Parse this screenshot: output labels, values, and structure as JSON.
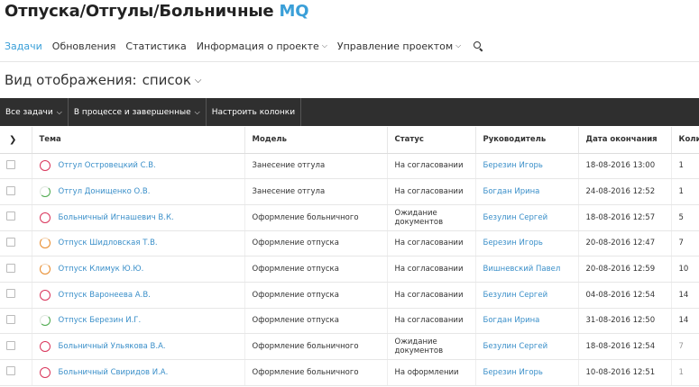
{
  "app": {
    "title_main": "Отпуска/Отгулы/Больничные",
    "title_accent": "MQ"
  },
  "nav": {
    "items": [
      {
        "label": "Задачи",
        "active": true,
        "dropdown": false
      },
      {
        "label": "Обновления",
        "active": false,
        "dropdown": false
      },
      {
        "label": "Статистика",
        "active": false,
        "dropdown": false
      },
      {
        "label": "Информация о проекте",
        "active": false,
        "dropdown": true
      },
      {
        "label": "Управление проектом",
        "active": false,
        "dropdown": true
      }
    ],
    "search_icon": "search-icon"
  },
  "view": {
    "label": "Вид отображения:",
    "value": "список"
  },
  "toolbar": {
    "all_tasks": "Все задачи",
    "in_progress": "В процессе и завершенные",
    "configure": "Настроить колонки"
  },
  "table": {
    "columns": {
      "topic": "Тема",
      "model": "Модель",
      "status": "Статус",
      "manager": "Руководитель",
      "end_date": "Дата окончания",
      "count": "Коли"
    },
    "rows": [
      {
        "topic": "Отгул Островецкий С.В.",
        "model": "Занесение отгула",
        "status": "На согласовании",
        "manager": "Березин Игорь",
        "end_date": "18-08-2016 13:00",
        "count": "1",
        "icon": "red"
      },
      {
        "topic": "Отгул Донищенко О.В.",
        "model": "Занесение отгула",
        "status": "На согласовании",
        "manager": "Богдан Ирина",
        "end_date": "24-08-2016 12:52",
        "count": "1",
        "icon": "green"
      },
      {
        "topic": "Больничный Игнашевич В.К.",
        "model": "Оформление больничного",
        "status": "Ожидание документов",
        "manager": "Безулин Сергей",
        "end_date": "18-08-2016 12:57",
        "count": "5",
        "icon": "red"
      },
      {
        "topic": "Отпуск Шидловская Т.В.",
        "model": "Оформление отпуска",
        "status": "На согласовании",
        "manager": "Березин Игорь",
        "end_date": "20-08-2016 12:47",
        "count": "7",
        "icon": "orange"
      },
      {
        "topic": "Отпуск Климук Ю.Ю.",
        "model": "Оформление отпуска",
        "status": "На согласовании",
        "manager": "Вишневский Павел",
        "end_date": "20-08-2016 12:59",
        "count": "10",
        "icon": "orange"
      },
      {
        "topic": "Отпуск Варонеева А.В.",
        "model": "Оформление отпуска",
        "status": "На согласовании",
        "manager": "Безулин Сергей",
        "end_date": "04-08-2016 12:54",
        "count": "14",
        "icon": "red"
      },
      {
        "topic": "Отпуск Березин И.Г.",
        "model": "Оформление отпуска",
        "status": "На согласовании",
        "manager": "Богдан Ирина",
        "end_date": "31-08-2016 12:50",
        "count": "14",
        "icon": "green"
      },
      {
        "topic": "Больничный Ульякова В.А.",
        "model": "Оформление больничного",
        "status": "Ожидание документов",
        "manager": "Безулин Сергей",
        "end_date": "18-08-2016 12:54",
        "count": "7",
        "icon": "red",
        "muted": true
      },
      {
        "topic": "Больничный Свиридов И.А.",
        "model": "Оформление больничного",
        "status": "На оформлении",
        "manager": "Березин Игорь",
        "end_date": "10-08-2016 12:51",
        "count": "1",
        "icon": "red",
        "muted": true
      }
    ]
  },
  "colors": {
    "accent": "#3a9fd8",
    "toolbar_bg": "#2f2f2f",
    "ring_red": "#d9345a",
    "ring_orange": "#e88a2a",
    "ring_green": "#4aa84a"
  }
}
